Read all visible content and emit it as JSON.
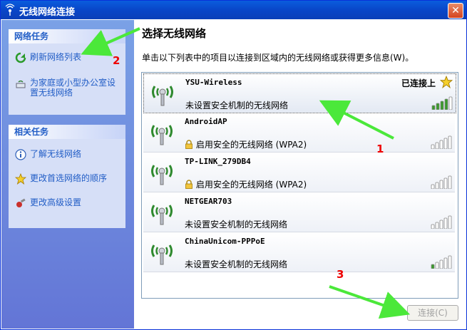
{
  "window": {
    "title": "无线网络连接",
    "close_label": "✕"
  },
  "left": {
    "network_tasks": {
      "header": "网络任务",
      "items": [
        {
          "label": "刷新网络列表",
          "icon": "refresh-icon"
        },
        {
          "label": "为家庭或小型办公室设置无线网络",
          "icon": "wireless-setup-icon"
        }
      ]
    },
    "related_tasks": {
      "header": "相关任务",
      "items": [
        {
          "label": "了解无线网络",
          "icon": "info-icon"
        },
        {
          "label": "更改首选网络的顺序",
          "icon": "star-icon"
        },
        {
          "label": "更改高级设置",
          "icon": "advanced-settings-icon"
        }
      ]
    }
  },
  "main": {
    "heading": "选择无线网络",
    "hint": "单击以下列表中的项目以连接到区域内的无线网络或获得更多信息(W)。"
  },
  "networks": [
    {
      "ssid": "YSU-Wireless",
      "security": "未设置安全机制的无线网络",
      "secured": false,
      "status": "已连接上",
      "signal": 4
    },
    {
      "ssid": "AndroidAP",
      "security": "启用安全的无线网络 (WPA2)",
      "secured": true,
      "status": "",
      "signal": 0
    },
    {
      "ssid": "TP-LINK_279DB4",
      "security": "启用安全的无线网络 (WPA2)",
      "secured": true,
      "status": "",
      "signal": 0
    },
    {
      "ssid": "NETGEAR703",
      "security": "未设置安全机制的无线网络",
      "secured": false,
      "status": "",
      "signal": 0
    },
    {
      "ssid": "ChinaUnicom-PPPoE",
      "security": "未设置安全机制的无线网络",
      "secured": false,
      "status": "",
      "signal": 1
    }
  ],
  "connect_button": "连接(C)",
  "annotations": [
    "1",
    "2",
    "3"
  ],
  "colors": {
    "title_bar": "#0a4fd0",
    "task_link": "#215dc6",
    "annotation_arrow": "#4be83a",
    "annotation_number": "#e00000"
  }
}
